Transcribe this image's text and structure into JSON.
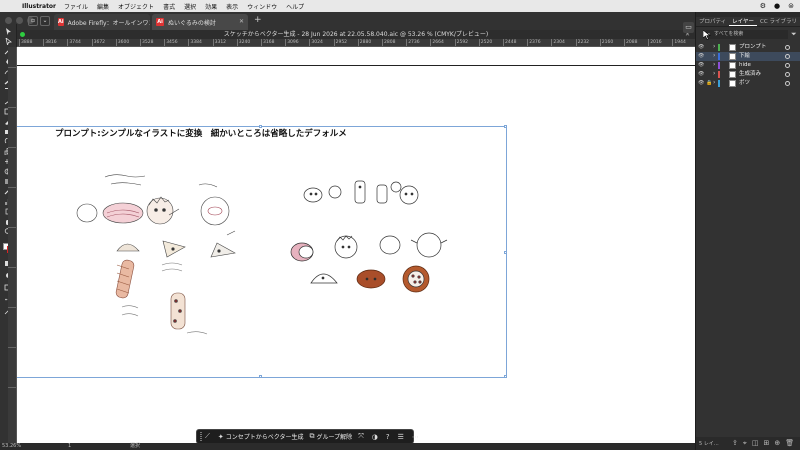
{
  "menubar": {
    "app": "Illustrator",
    "items": [
      "ファイル",
      "編集",
      "オブジェクト",
      "書式",
      "選択",
      "効果",
      "表示",
      "ウィンドウ",
      "ヘルプ"
    ]
  },
  "tabs": [
    {
      "label": "Adobe Firefly：オールインワン…"
    },
    {
      "label": "ぬいぐるみの検討"
    }
  ],
  "document": {
    "title": "スケッチからベクター生成 - 28 Jun 2026 at 22.05.58.040.aic @ 53.26 % (CMYK/プレビュー)"
  },
  "ruler": {
    "ticks": [
      "3888",
      "3816",
      "3744",
      "3672",
      "3600",
      "3528",
      "3456",
      "3384",
      "3312",
      "3240",
      "3168",
      "3096",
      "3024",
      "2952",
      "2880",
      "2808",
      "2736",
      "2664",
      "2592",
      "2520",
      "2448",
      "2376",
      "2304",
      "2232",
      "2160",
      "2088",
      "2016",
      "1944",
      "1872"
    ]
  },
  "canvas": {
    "prompt": "プロンプト:シンプルなイラストに変換　細かいところは省略したデフォルメ"
  },
  "statusbar": {
    "zoom": "53.26%",
    "page": "1",
    "selection": "選択"
  },
  "taskbar": {
    "concept_label": "コンセプトからベクター生成",
    "ungroup_label": "グループ解除"
  },
  "panel": {
    "tabs": [
      "プロパティ",
      "レイヤー",
      "CC ライブラリ"
    ],
    "active_tab": 1,
    "search_placeholder": "すべてを検索",
    "layers": [
      {
        "name": "プロンプト",
        "color": "#4caf50",
        "selected": false
      },
      {
        "name": "下絵",
        "color": "#3b6fd8",
        "selected": true
      },
      {
        "name": "hide",
        "color": "#8c4fd6",
        "selected": false
      },
      {
        "name": "生成済み",
        "color": "#d9534f",
        "selected": false
      },
      {
        "name": "ボツ",
        "color": "#3aa0d8",
        "selected": false
      }
    ],
    "footer_count": "5 レイ…"
  },
  "colors": {
    "accent": "#7da6d8",
    "panel_bg": "#323232"
  }
}
